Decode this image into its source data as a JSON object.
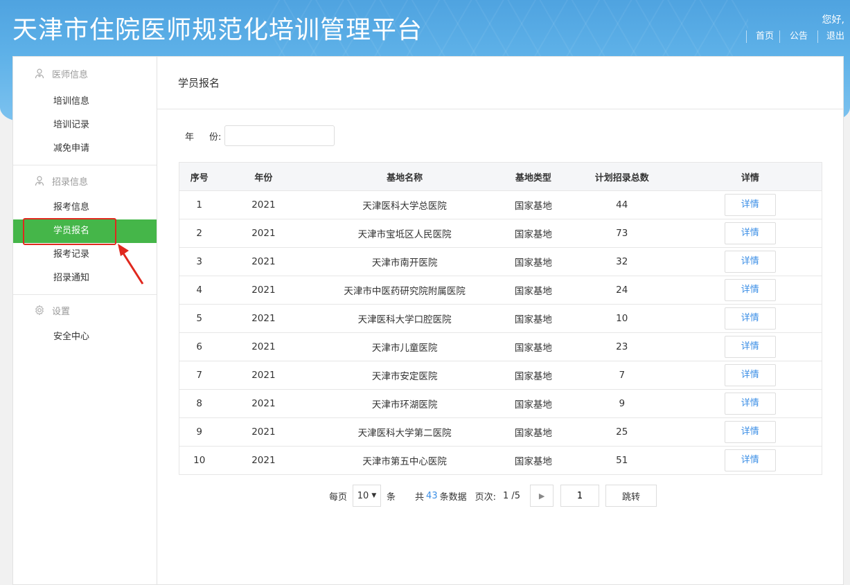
{
  "header": {
    "title": "天津市住院医师规范化培训管理平台",
    "greeting": "您好,",
    "nav": [
      "首页",
      "公告",
      "退出"
    ]
  },
  "sidebar": {
    "groups": [
      {
        "title": "医师信息",
        "icon": "doctor-icon",
        "items": [
          "培训信息",
          "培训记录",
          "减免申请"
        ]
      },
      {
        "title": "招录信息",
        "icon": "doctor-icon",
        "items": [
          "报考信息",
          "学员报名",
          "报考记录",
          "招录通知"
        ]
      },
      {
        "title": "设置",
        "icon": "gear-icon",
        "items": [
          "安全中心"
        ]
      }
    ],
    "active_item": "学员报名"
  },
  "main": {
    "title": "学员报名",
    "filter": {
      "label_a": "年",
      "label_b": "份:",
      "value": ""
    },
    "table": {
      "columns": [
        "序号",
        "年份",
        "基地名称",
        "基地类型",
        "计划招录总数",
        "详情"
      ],
      "rows": [
        [
          "1",
          "2021",
          "天津医科大学总医院",
          "国家基地",
          "44",
          "详情"
        ],
        [
          "2",
          "2021",
          "天津市宝坻区人民医院",
          "国家基地",
          "73",
          "详情"
        ],
        [
          "3",
          "2021",
          "天津市南开医院",
          "国家基地",
          "32",
          "详情"
        ],
        [
          "4",
          "2021",
          "天津市中医药研究院附属医院",
          "国家基地",
          "24",
          "详情"
        ],
        [
          "5",
          "2021",
          "天津医科大学口腔医院",
          "国家基地",
          "10",
          "详情"
        ],
        [
          "6",
          "2021",
          "天津市儿童医院",
          "国家基地",
          "23",
          "详情"
        ],
        [
          "7",
          "2021",
          "天津市安定医院",
          "国家基地",
          "7",
          "详情"
        ],
        [
          "8",
          "2021",
          "天津市环湖医院",
          "国家基地",
          "9",
          "详情"
        ],
        [
          "9",
          "2021",
          "天津医科大学第二医院",
          "国家基地",
          "25",
          "详情"
        ],
        [
          "10",
          "2021",
          "天津市第五中心医院",
          "国家基地",
          "51",
          "详情"
        ]
      ]
    },
    "pager": {
      "per_page_label": "每页",
      "per_page_value": "10",
      "per_page_unit": "条",
      "total_prefix": "共",
      "total": "43",
      "total_suffix": "条数据",
      "page_label": "页次:",
      "page_status": "1 /5",
      "page_input": "1",
      "go_label": "跳转"
    }
  },
  "colors": {
    "header": "#5eb1e8",
    "active": "#45b649",
    "link": "#3a8ee6",
    "annotation": "#e0281e"
  }
}
